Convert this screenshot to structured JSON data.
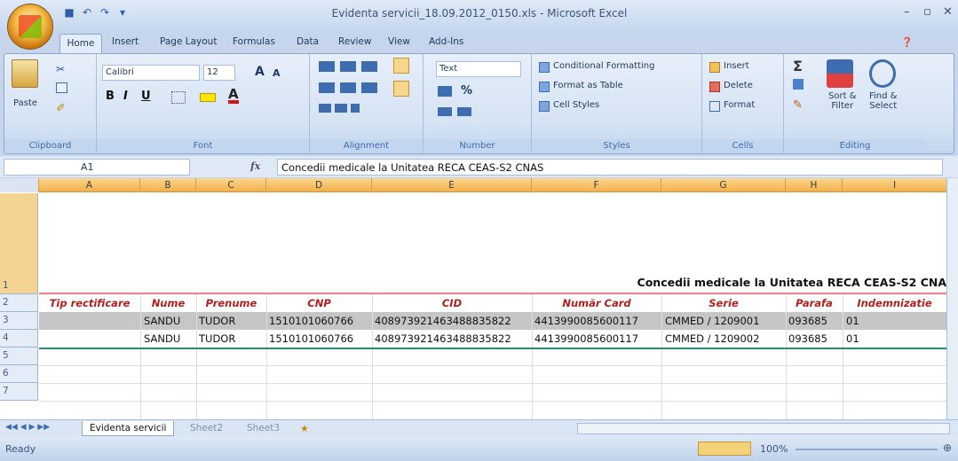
{
  "window": {
    "title": "Evidenta servicii_18.09.2012_0150.xls - Microsoft Excel"
  },
  "tabs": [
    "Home",
    "Insert",
    "Page Layout",
    "Formulas",
    "Data",
    "Review",
    "View",
    "Add-Ins"
  ],
  "ribbon": {
    "clipboard": {
      "paste": "Paste",
      "label": "Clipboard"
    },
    "font": {
      "name": "Calibri",
      "size": "12",
      "label": "Font",
      "grow": "A",
      "shrink": "A",
      "bold": "B",
      "italic": "I",
      "underline": "U"
    },
    "alignment": {
      "label": "Alignment"
    },
    "number": {
      "format": "Text",
      "percent": "%",
      "label": "Number"
    },
    "styles": {
      "conditional": "Conditional Formatting",
      "format_table": "Format as Table",
      "cell_styles": "Cell Styles",
      "label": "Styles"
    },
    "cells": {
      "insert": "Insert",
      "delete": "Delete",
      "format": "Format",
      "label": "Cells"
    },
    "editing": {
      "sort": "Sort &",
      "sort2": "Filter",
      "find": "Find &",
      "find2": "Select",
      "label": "Editing"
    }
  },
  "formula_bar": {
    "name_box": "A1",
    "fx": "fx",
    "content": "Concedii medicale la Unitatea RECA CEAS-S2 CNAS"
  },
  "columns": [
    "A",
    "B",
    "C",
    "D",
    "E",
    "F",
    "G",
    "H",
    "I"
  ],
  "rows": [
    "1",
    "2",
    "3",
    "4",
    "5",
    "6",
    "7"
  ],
  "sheet": {
    "title": "Concedii medicale la Unitatea RECA CEAS-S2 CNA",
    "headers": [
      "Tip rectificare",
      "Nume",
      "Prenume",
      "CNP",
      "CID",
      "Număr Card",
      "Serie",
      "Parafa",
      "Indemnizatie"
    ],
    "data": [
      [
        "",
        "SANDU",
        "TUDOR",
        "1510101060766",
        "408973921463488835822",
        "4413990085600117",
        "CMMED / 1209001",
        "093685",
        "01"
      ],
      [
        "",
        "SANDU",
        "TUDOR",
        "1510101060766",
        "408973921463488835822",
        "4413990085600117",
        "CMMED / 1209002",
        "093685",
        "01"
      ]
    ]
  },
  "sheet_tabs": [
    "Evidenta servicii",
    "Sheet2",
    "Sheet3"
  ],
  "status": {
    "ready": "Ready",
    "zoom": "100%"
  }
}
